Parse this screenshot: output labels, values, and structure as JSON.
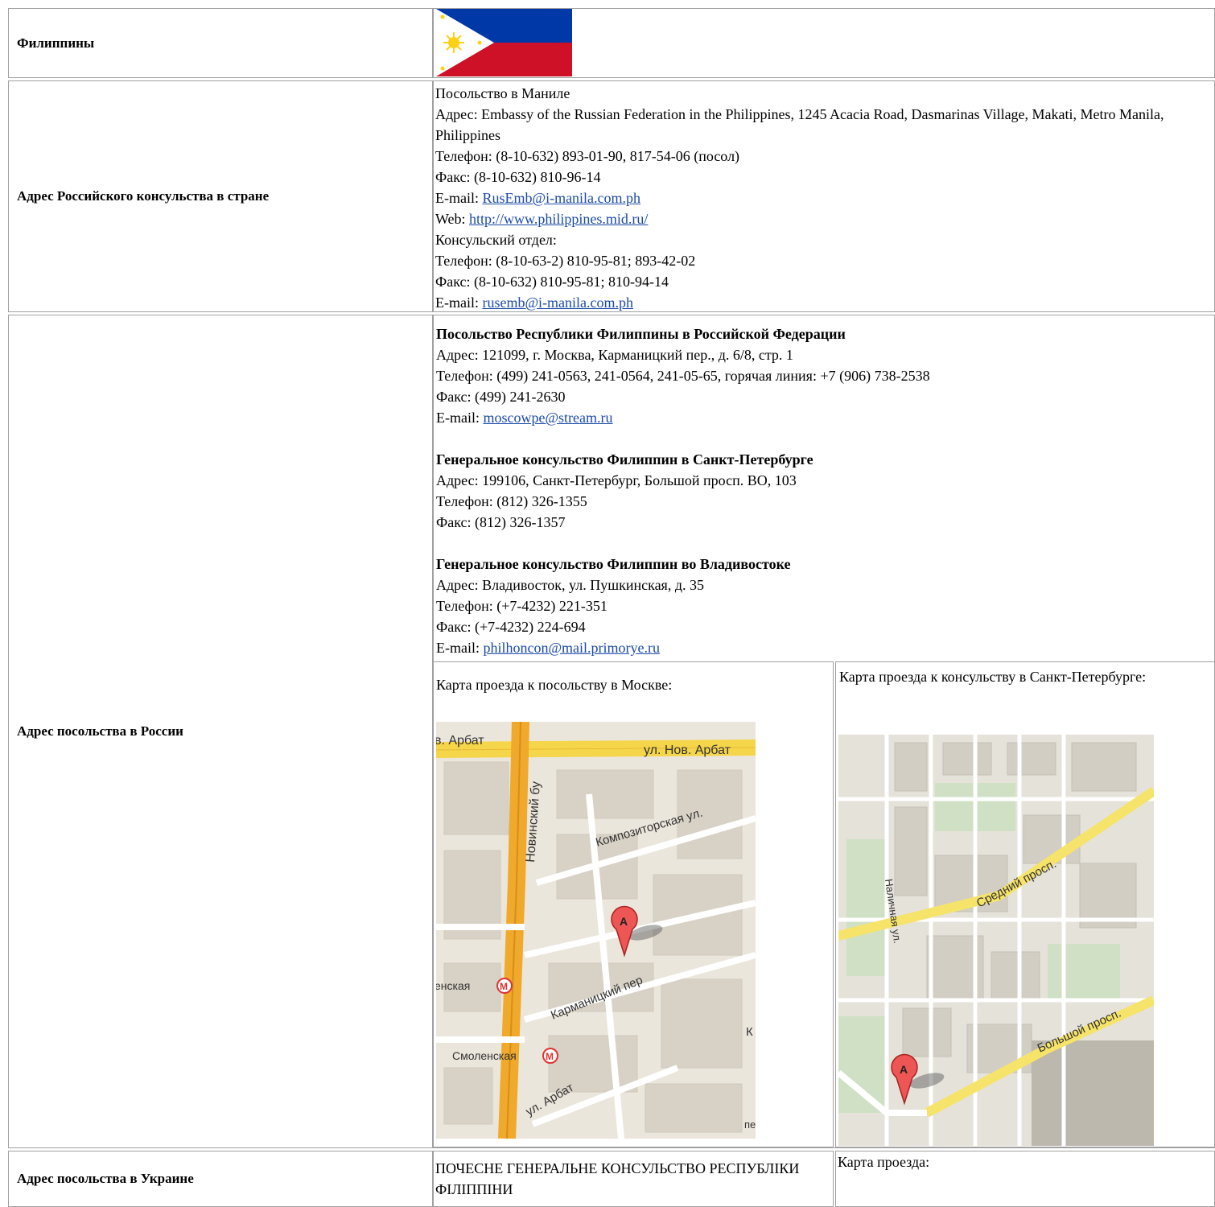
{
  "country": {
    "label": "Филиппины",
    "flag_icon": "philippines-flag-icon",
    "colors": {
      "blue": "#0038a8",
      "red": "#ce1126",
      "white": "#ffffff",
      "sun": "#fcd116"
    }
  },
  "russian_consulate": {
    "label": "Адрес Российского консульства в стране",
    "lines": [
      "Посольство в Маниле",
      "Адрес: Embassy of the Russian Federation in the Philippines, 1245 Acacia Road, Dasmarinas Village, Makati, Metro Manila, Philippines",
      "Телефон: (8-10-632) 893-01-90, 817-54-06 (посол)",
      "Факс: (8-10-632) 810-96-14"
    ],
    "email_prefix": "E-mail: ",
    "email": "RusEmb@i-manila.com.ph",
    "web_prefix": "Web: ",
    "web": "http://www.philippines.mid.ru/",
    "consular_lines": [
      "Консульский отдел:",
      "Телефон: (8-10-63-2) 810-95-81; 893-42-02",
      "Факс: (8-10-632) 810-95-81; 810-94-14"
    ],
    "consular_email_prefix": "E-mail: ",
    "consular_email": "rusemb@i-manila.com.ph"
  },
  "embassy_russia": {
    "label": "Адрес посольства в России",
    "moscow": {
      "title": "Посольство Республики Филиппины в Российской Федерации",
      "address": "Адрес: 121099, г. Москва, Карманицкий пер., д. 6/8, стр. 1",
      "phone": "Телефон: (499) 241-0563, 241-0564, 241-05-65, горячая линия: +7 (906) 738-2538",
      "fax": "Факс: (499) 241-2630",
      "email_prefix": "E-mail: ",
      "email": "moscowpe@stream.ru"
    },
    "spb": {
      "title": "Генеральное консульство Филиппин в Санкт-Петербурге",
      "address": "Адрес: 199106, Санкт-Петербург, Большой просп. ВО, 103",
      "phone": "Телефон: (812) 326-1355",
      "fax": "Факс: (812) 326-1357"
    },
    "vladivostok": {
      "title": "Генеральное консульство Филиппин во Владивостоке",
      "address": "Адрес: Владивосток, ул. Пушкинская, д. 35",
      "phone": "Телефон: (+7-4232) 221-351",
      "fax": "Факс: (+7-4232) 224-694",
      "email_prefix": "E-mail: ",
      "email": "philhoncon@mail.primorye.ru"
    },
    "map_moscow": {
      "caption": "Карта проезда к посольству в Москве:",
      "streets": [
        "в. Арбат",
        "ул. Нов. Арбат",
        "Новинский бу",
        "Композиторская ул.",
        "Карманицкий пер",
        "енская",
        "Смоленская",
        "ул. Арбат",
        "К",
        "пе"
      ],
      "marker": "A"
    },
    "map_spb": {
      "caption": "Карта проезда к консульству в Санкт-Петербурге:",
      "streets": [
        "Средний просп.",
        "Большой просп.",
        "Наличная ул."
      ],
      "marker": "A"
    }
  },
  "embassy_ukraine": {
    "label": "Адрес посольства в Украине",
    "text": "ПОЧЕСНЕ ГЕНЕРАЛЬНЕ КОНСУЛЬСТВО РЕСПУБЛІКИ ФІЛІППІНИ",
    "map_caption": "Карта проезда:"
  }
}
